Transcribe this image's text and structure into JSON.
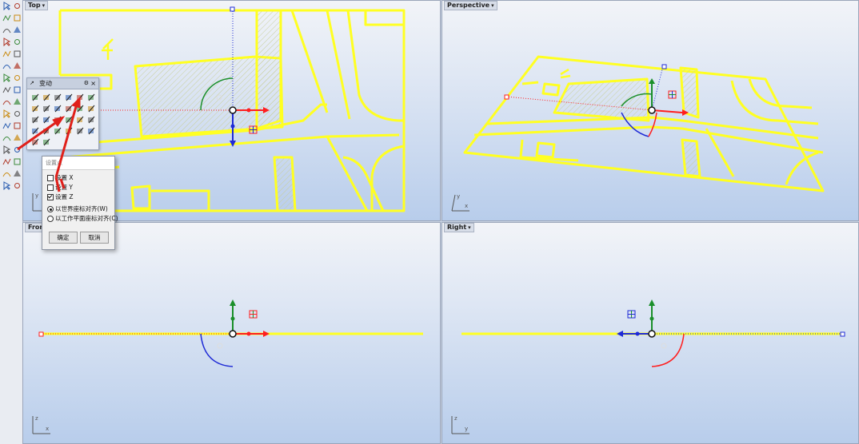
{
  "viewports": {
    "top": {
      "label": "Top"
    },
    "perspective": {
      "label": "Perspective"
    },
    "front": {
      "label": "Front"
    },
    "right": {
      "label": "Right"
    }
  },
  "dropdown_glyph": "▾",
  "axis_labels": {
    "top": {
      "h": "x",
      "v": "y"
    },
    "perspective": {
      "h": "x",
      "v": "y"
    },
    "front": {
      "h": "x",
      "v": "z"
    },
    "right": {
      "h": "y",
      "v": "z"
    }
  },
  "transform_panel": {
    "title": "变动",
    "close_glyph": "×",
    "gear_glyph": "⚙",
    "pin_glyph": "↗"
  },
  "dialog": {
    "title": "设置点",
    "options": [
      {
        "label": "设置 X",
        "checked": false
      },
      {
        "label": "设置 Y",
        "checked": false
      },
      {
        "label": "设置 Z",
        "checked": true
      }
    ],
    "radios": [
      {
        "label": "以世界座标对齐(W)",
        "selected": true
      },
      {
        "label": "以工作平面座标对齐(C)",
        "selected": false
      }
    ],
    "ok_label": "确定",
    "cancel_label": "取消"
  },
  "colors": {
    "geometry": "#ffff22",
    "gumball_x": "#ff1e1e",
    "gumball_y": "#1a8f2a",
    "gumball_z": "#1e2ad6",
    "annotation_arrow": "#e0201a"
  },
  "icons": {
    "toolbar": [
      "select-icon",
      "point-icon",
      "polyline-icon",
      "curve-icon",
      "circle-icon",
      "ellipse-icon",
      "arc-icon",
      "rectangle-icon",
      "polygon-icon",
      "text-icon",
      "extrude-icon",
      "surface-icon",
      "solid-icon",
      "sphere-icon",
      "boolean-icon",
      "fillet-icon",
      "move-icon",
      "copy-icon",
      "rotate-icon",
      "scale-icon",
      "mirror-icon",
      "array-icon",
      "trim-icon",
      "split-icon",
      "join-icon",
      "explode-icon",
      "group-icon",
      "hide-icon",
      "lock-icon",
      "layer-icon",
      "dimension-icon",
      "render-icon"
    ]
  }
}
